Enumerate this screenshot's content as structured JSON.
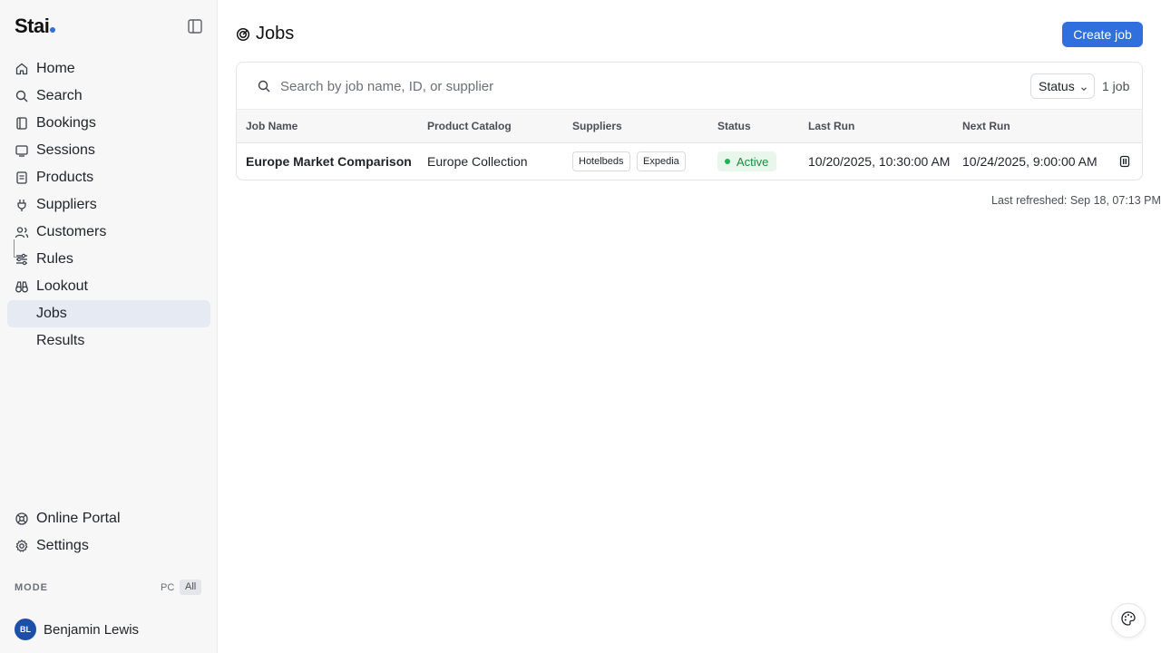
{
  "app": {
    "logo_text": "Stai",
    "accent_color": "#2f6fde"
  },
  "sidebar": {
    "items": [
      {
        "label": "Home",
        "icon": "home-icon"
      },
      {
        "label": "Search",
        "icon": "search-icon"
      },
      {
        "label": "Bookings",
        "icon": "bookings-icon"
      },
      {
        "label": "Sessions",
        "icon": "sessions-icon"
      },
      {
        "label": "Products",
        "icon": "products-icon"
      },
      {
        "label": "Suppliers",
        "icon": "suppliers-icon"
      },
      {
        "label": "Customers",
        "icon": "customers-icon"
      },
      {
        "label": "Rules",
        "icon": "rules-icon"
      },
      {
        "label": "Lookout",
        "icon": "binoculars-icon"
      },
      {
        "label": "Jobs",
        "active": true
      },
      {
        "label": "Results"
      }
    ],
    "bottom": [
      {
        "label": "Online Portal",
        "icon": "portal-icon"
      },
      {
        "label": "Settings",
        "icon": "gear-icon"
      }
    ],
    "mode": {
      "label": "MODE",
      "pc": "PC",
      "all": "All"
    },
    "user": {
      "initials": "BL",
      "name": "Benjamin Lewis"
    }
  },
  "header": {
    "title": "Jobs",
    "create_label": "Create job"
  },
  "filters": {
    "search_placeholder": "Search by job name, ID, or supplier",
    "status_label": "Status",
    "count": "1 job"
  },
  "table": {
    "headers": [
      "Job Name",
      "Product Catalog",
      "Suppliers",
      "Status",
      "Last Run",
      "Next Run"
    ],
    "rows": [
      {
        "job_name": "Europe Market Comparison",
        "product_catalog": "Europe Collection",
        "suppliers": [
          "Hotelbeds",
          "Expedia"
        ],
        "status": "Active",
        "last_run": "10/20/2025, 10:30:00 AM",
        "next_run": "10/24/2025, 9:00:00 AM"
      }
    ]
  },
  "footer": {
    "last_refreshed": "Last refreshed: Sep 18, 07:13 PM"
  }
}
